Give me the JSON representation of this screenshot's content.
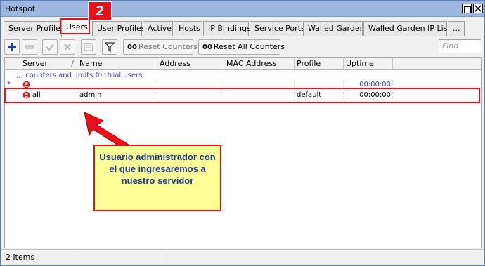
{
  "window": {
    "title": "Hotspot"
  },
  "tabs": [
    {
      "label": "Server Profiles"
    },
    {
      "label": "Users"
    },
    {
      "label": "User Profiles"
    },
    {
      "label": "Active"
    },
    {
      "label": "Hosts"
    },
    {
      "label": "IP Bindings"
    },
    {
      "label": "Service Ports"
    },
    {
      "label": "Walled Garden"
    },
    {
      "label": "Walled Garden IP List"
    },
    {
      "label": "..."
    }
  ],
  "toolbar": {
    "reset_counters": {
      "prefix": "00",
      "label": "Reset Counters"
    },
    "reset_all_counters": {
      "prefix": "00",
      "label": "Reset All Counters"
    },
    "find_placeholder": "Find",
    "icons": [
      "add-icon",
      "remove-icon",
      "enable-icon",
      "disable-icon",
      "comment-icon",
      "filter-icon"
    ]
  },
  "table": {
    "columns": [
      "Server",
      "Name",
      "Address",
      "MAC Address",
      "Profile",
      "Uptime"
    ],
    "sort_indicator": "/",
    "comment": ";;; counters and limits for trial users",
    "rows": [
      {
        "flag": "*",
        "server": "",
        "name": "",
        "address": "",
        "mac": "",
        "profile": "",
        "uptime": "00:00:00"
      },
      {
        "flag": "",
        "server": "all",
        "name": "admin",
        "address": "",
        "mac": "",
        "profile": "default",
        "uptime": "00:00:00"
      }
    ]
  },
  "status": {
    "items": "2 items"
  },
  "annotations": {
    "step_number": "2",
    "callout_text": "Usuario administrador con el que ingresaremos a nuestro servidor"
  },
  "colors": {
    "highlight": "#e8101a",
    "callout_bg": "#ffff99",
    "callout_text": "#1d3d8a",
    "titlebar": "#9cb6e0"
  }
}
